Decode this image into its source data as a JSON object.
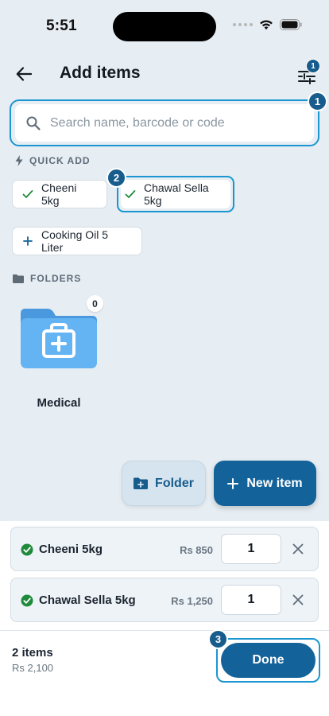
{
  "status_bar": {
    "time": "5:51"
  },
  "header": {
    "title": "Add items",
    "filter_badge": "1"
  },
  "search": {
    "placeholder": "Search name, barcode or code",
    "value": ""
  },
  "annotations": {
    "search": "1",
    "chip": "2",
    "done": "3"
  },
  "quick_add": {
    "label": "QUICK ADD",
    "chips": [
      {
        "label": "Cheeni 5kg",
        "state": "added"
      },
      {
        "label": "Chawal Sella 5kg",
        "state": "added"
      },
      {
        "label": "Cooking Oil 5 Liter",
        "state": "add"
      }
    ]
  },
  "folders": {
    "label": "FOLDERS",
    "items": [
      {
        "name": "Medical",
        "count": "0"
      }
    ]
  },
  "actions": {
    "folder_label": "Folder",
    "new_item_label": "New item"
  },
  "cart": {
    "items": [
      {
        "name": "Cheeni 5kg",
        "price": "Rs 850",
        "qty": "1"
      },
      {
        "name": "Chawal Sella 5kg",
        "price": "Rs 1,250",
        "qty": "1"
      }
    ],
    "count_label": "2 items",
    "total": "Rs 2,100",
    "done_label": "Done"
  },
  "colors": {
    "primary": "#13639a",
    "highlight": "#1a96d1",
    "check_green": "#1f8a3b",
    "folder_blue": "#5aaef0",
    "background": "#e6edf3"
  },
  "icons": {
    "back": "arrow-left-icon",
    "filter": "sliders-icon",
    "search": "magnifier-icon",
    "quick_add": "bolt-icon",
    "folders": "folder-icon",
    "folder_tile": "medical-kit-icon",
    "new_folder": "folder-plus-icon",
    "added": "check-circle-icon",
    "remove": "close-icon"
  }
}
